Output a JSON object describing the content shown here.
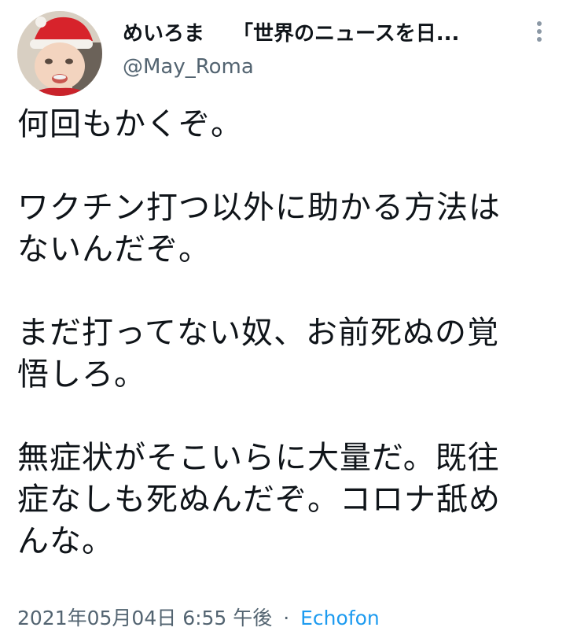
{
  "tweet": {
    "author": {
      "display_name": "めいろま",
      "display_suffix": "「世界のニュースを日...",
      "handle": "@May_Roma"
    },
    "avatar_icon": "baby-in-santa-hat-avatar",
    "more_icon": "vertical-ellipsis-icon",
    "paragraphs": [
      "何回もかくぞ。",
      "ワクチン打つ以外に助かる方法は\nないんだぞ。",
      "まだ打ってない奴、お前死ぬの覚\n悟しろ。",
      "無症状がそこいらに大量だ。既往\n症なしも死ぬんだぞ。コロナ舐め\nんな。"
    ],
    "timestamp": "2021年05月04日 6:55 午後",
    "separator": "·",
    "source": "Echofon"
  },
  "colors": {
    "text": "#0f1419",
    "secondary": "#536471",
    "link": "#1d9bf0"
  }
}
